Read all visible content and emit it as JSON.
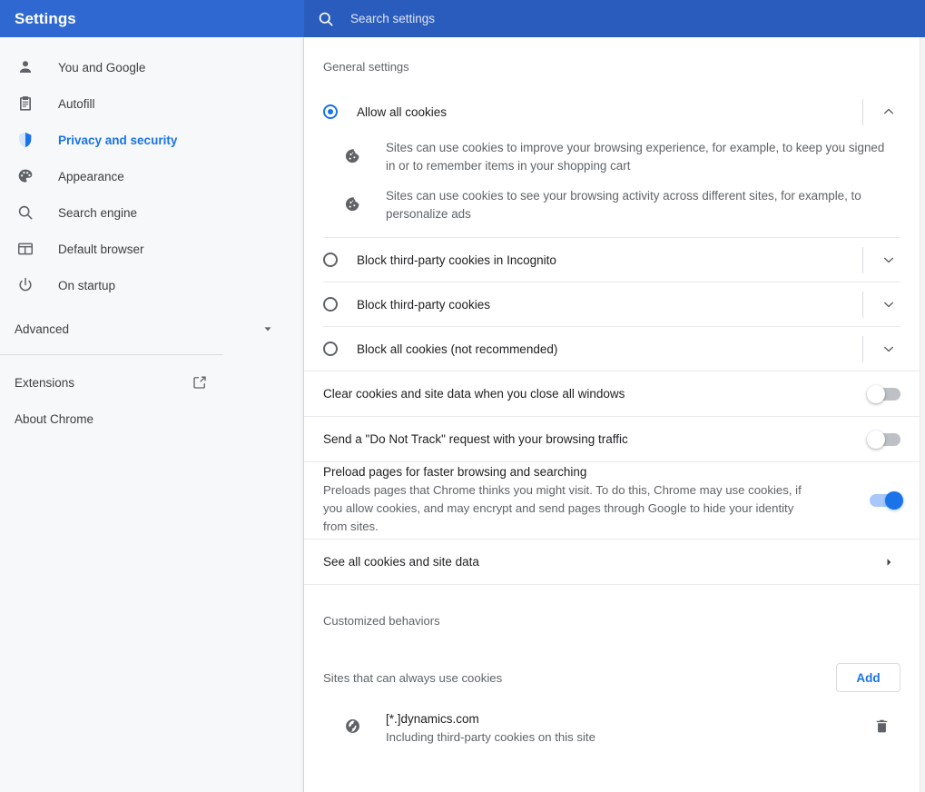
{
  "header": {
    "title": "Settings",
    "search_placeholder": "Search settings",
    "search_value": "",
    "search_icon": "search-icon",
    "bar_color": "#2f68d0",
    "searchbox_color": "#2a5cbd"
  },
  "sidebar": {
    "items": [
      {
        "label": "You and Google",
        "icon": "person-icon",
        "active": false
      },
      {
        "label": "Autofill",
        "icon": "clipboard-icon",
        "active": false
      },
      {
        "label": "Privacy and security",
        "icon": "shield-icon",
        "active": true
      },
      {
        "label": "Appearance",
        "icon": "palette-icon",
        "active": false
      },
      {
        "label": "Search engine",
        "icon": "search-icon",
        "active": false
      },
      {
        "label": "Default browser",
        "icon": "browser-window-icon",
        "active": false
      },
      {
        "label": "On startup",
        "icon": "power-icon",
        "active": false
      }
    ],
    "advanced": {
      "label": "Advanced",
      "icon": "chevron-down-icon"
    },
    "bottom_items": [
      {
        "label": "Extensions",
        "icon": "external-link-icon"
      },
      {
        "label": "About Chrome",
        "icon": ""
      }
    ],
    "active_color": "#1a73e8"
  },
  "main": {
    "general_settings_title": "General settings",
    "cookie_options": [
      {
        "label": "Allow all cookies",
        "selected": true,
        "expanded": true,
        "chevron": "chevron-up-icon",
        "descriptions": [
          {
            "icon": "cookie-icon",
            "text": "Sites can use cookies to improve your browsing experience, for example, to keep you signed in or to remember items in your shopping cart"
          },
          {
            "icon": "cookie-icon",
            "text": "Sites can use cookies to see your browsing activity across different sites, for example, to personalize ads"
          }
        ]
      },
      {
        "label": "Block third-party cookies in Incognito",
        "selected": false,
        "expanded": false,
        "chevron": "chevron-down-icon",
        "descriptions": []
      },
      {
        "label": "Block third-party cookies",
        "selected": false,
        "expanded": false,
        "chevron": "chevron-down-icon",
        "descriptions": []
      },
      {
        "label": "Block all cookies (not recommended)",
        "selected": false,
        "expanded": false,
        "chevron": "chevron-down-icon",
        "descriptions": []
      }
    ],
    "toggles": [
      {
        "title": "Clear cookies and site data when you close all windows",
        "subtitle": "",
        "on": false
      },
      {
        "title": "Send a \"Do Not Track\" request with your browsing traffic",
        "subtitle": "",
        "on": false
      },
      {
        "title": "Preload pages for faster browsing and searching",
        "subtitle": "Preloads pages that Chrome thinks you might visit. To do this, Chrome may use cookies, if you allow cookies, and may encrypt and send pages through Google to hide your identity from sites.",
        "on": true
      }
    ],
    "see_all_cookies": {
      "label": "See all cookies and site data",
      "icon": "arrow-right-icon"
    },
    "customized_behaviors_title": "Customized behaviors",
    "sites_always_allow": {
      "label": "Sites that can always use cookies",
      "add_button": "Add",
      "entries": [
        {
          "icon": "globe-icon",
          "name": "[*.]dynamics.com",
          "sub": "Including third-party cookies on this site",
          "delete_icon": "trash-icon"
        }
      ]
    }
  },
  "colors": {
    "accent": "#1a73e8",
    "toggle_on_track": "#a8c7fa",
    "toggle_off_track": "#bdc1c6",
    "text_primary": "#202124",
    "text_secondary": "#5f6368",
    "sidebar_bg": "#f7f8f9"
  }
}
